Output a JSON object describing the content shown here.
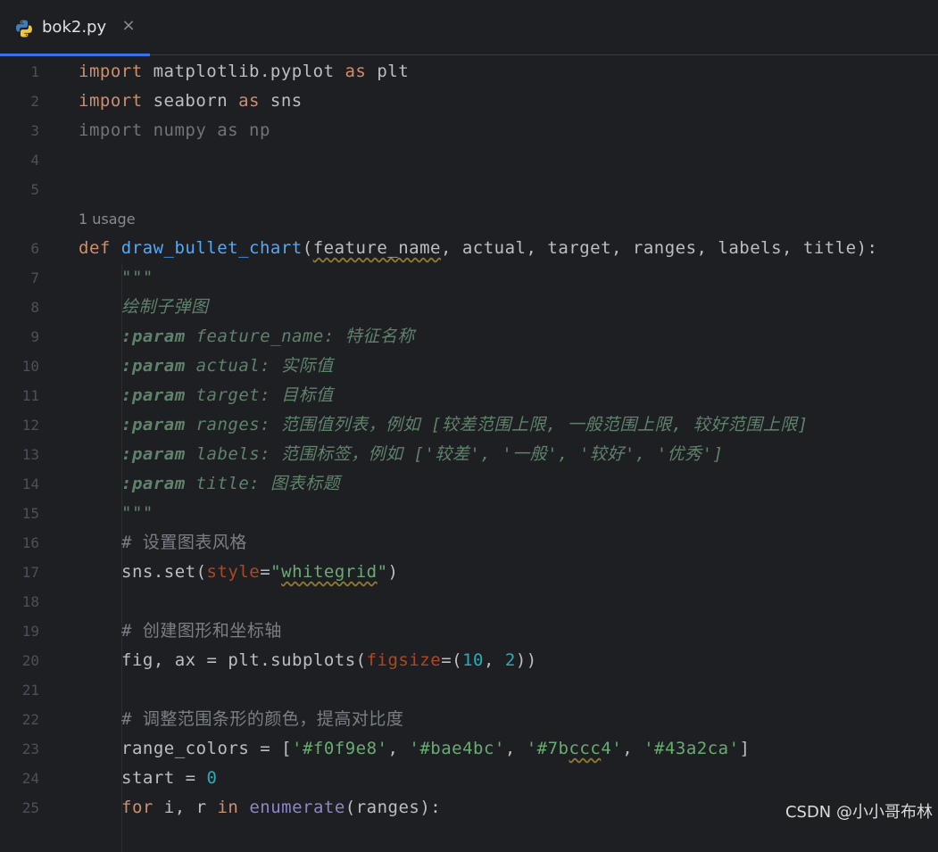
{
  "tab": {
    "title": "bok2.py",
    "close": "×",
    "icon": "python-file-icon"
  },
  "inlay_hint": "1 usage",
  "line_numbers": [
    "1",
    "2",
    "3",
    "4",
    "5",
    "6",
    "7",
    "8",
    "9",
    "10",
    "11",
    "12",
    "13",
    "14",
    "15",
    "16",
    "17",
    "18",
    "19",
    "20",
    "21",
    "22",
    "23",
    "24",
    "25"
  ],
  "code": {
    "l1": [
      "import",
      " matplotlib.pyplot ",
      "as",
      " plt"
    ],
    "l2": [
      "import",
      " seaborn ",
      "as",
      " sns"
    ],
    "l3": "import numpy as np",
    "l6": [
      "def",
      " ",
      "draw_bullet_chart",
      "(",
      "feature_name",
      ", actual, target, ranges, labels, title):"
    ],
    "l7": "\"\"\"",
    "l8": "绘制子弹图",
    "l9": [
      ":param",
      " feature_name: ",
      "特征名称"
    ],
    "l10": [
      ":param",
      " actual: ",
      "实际值"
    ],
    "l11": [
      ":param",
      " target: ",
      "目标值"
    ],
    "l12": [
      ":param",
      " ranges: ",
      "范围值列表，例如 [较差范围上限, 一般范围上限, 较好范围上限]"
    ],
    "l13": [
      ":param",
      " labels: ",
      "范围标签，例如 ['较差', '一般', '较好', '优秀']"
    ],
    "l14": [
      ":param",
      " title: ",
      "图表标题"
    ],
    "l15": "\"\"\"",
    "l16": "# 设置图表风格",
    "l17": [
      "sns.set(",
      "style",
      "=",
      "\"",
      "whitegrid",
      "\"",
      ")"
    ],
    "l19": "# 创建图形和坐标轴",
    "l20": [
      "fig, ax = plt.subplots(",
      "figsize",
      "=(",
      "10",
      ", ",
      "2",
      "))"
    ],
    "l22": "# 调整范围条形的颜色，提高对比度",
    "l23": [
      "range_colors = [",
      "'#f0f9e8'",
      ", ",
      "'#bae4bc'",
      ", ",
      "'#7b",
      "ccc",
      "4'",
      ", ",
      "'#43a2ca'",
      "]"
    ],
    "l24": [
      "start = ",
      "0"
    ],
    "l25": [
      "for",
      " i, r ",
      "in",
      " ",
      "enumerate",
      "(ranges):"
    ]
  },
  "colors": {
    "background": "#1e1f22",
    "keyword": "#cf8e6d",
    "function": "#56a8f5",
    "string": "#6aab73",
    "number": "#2aacb8",
    "kwarg": "#aa4926",
    "docstring": "#5f826b",
    "comment": "#7a7e85",
    "tab_accent": "#3574f0"
  },
  "watermark": "CSDN @小小哥布林"
}
